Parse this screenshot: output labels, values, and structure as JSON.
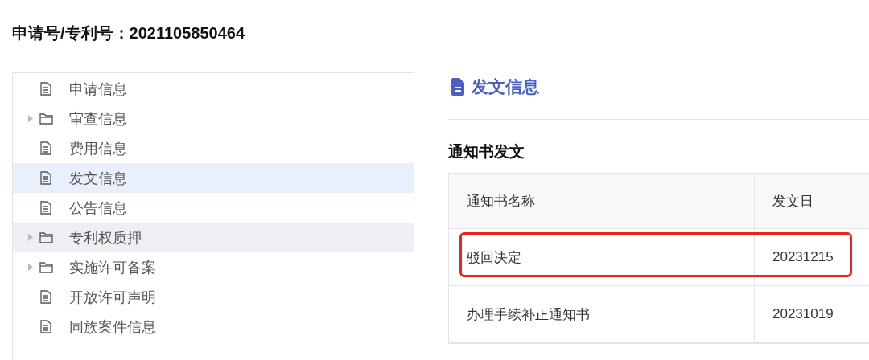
{
  "page_title": "申请号/专利号：2021105850464",
  "tree": {
    "items": [
      {
        "label": "申请信息",
        "kind": "file",
        "selected": false,
        "hovered": false
      },
      {
        "label": "审查信息",
        "kind": "folder",
        "selected": false,
        "hovered": false
      },
      {
        "label": "费用信息",
        "kind": "file",
        "selected": false,
        "hovered": false
      },
      {
        "label": "发文信息",
        "kind": "file",
        "selected": true,
        "hovered": false
      },
      {
        "label": "公告信息",
        "kind": "file",
        "selected": false,
        "hovered": false
      },
      {
        "label": "专利权质押",
        "kind": "folder",
        "selected": false,
        "hovered": true
      },
      {
        "label": "实施许可备案",
        "kind": "folder",
        "selected": false,
        "hovered": false
      },
      {
        "label": "开放许可声明",
        "kind": "file",
        "selected": false,
        "hovered": false
      },
      {
        "label": "同族案件信息",
        "kind": "file",
        "selected": false,
        "hovered": false
      }
    ]
  },
  "section": {
    "title": "发文信息",
    "subtitle": "通知书发文",
    "table": {
      "columns": [
        "通知书名称",
        "发文日"
      ],
      "rows": [
        {
          "cells": [
            "驳回决定",
            "20231215"
          ],
          "highlighted": true
        },
        {
          "cells": [
            "办理手续补正通知书",
            "20231019"
          ],
          "highlighted": false
        }
      ]
    }
  }
}
